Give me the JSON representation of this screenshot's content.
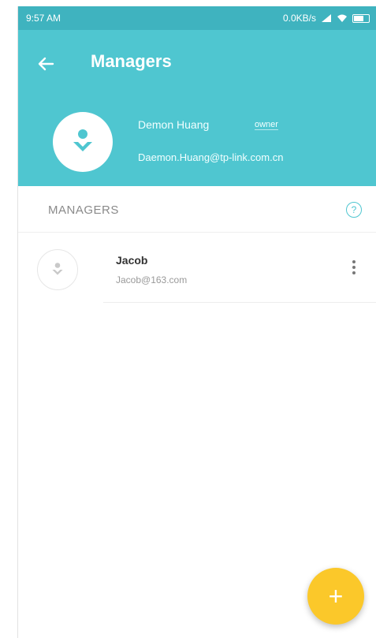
{
  "status_bar": {
    "time": "9:57 AM",
    "network_speed": "0.0KB/s"
  },
  "header": {
    "title": "Managers",
    "owner_name": "Demon Huang",
    "owner_badge": "owner",
    "owner_email": "Daemon.Huang@tp-link.com.cn"
  },
  "section": {
    "title": "MANAGERS",
    "help_symbol": "?"
  },
  "managers": [
    {
      "name": "Jacob",
      "email": "Jacob@163.com"
    }
  ],
  "fab": {
    "symbol": "+"
  },
  "colors": {
    "header": "#4fc6d0",
    "status_bar": "#3fb3bf",
    "fab": "#fbc82a"
  }
}
